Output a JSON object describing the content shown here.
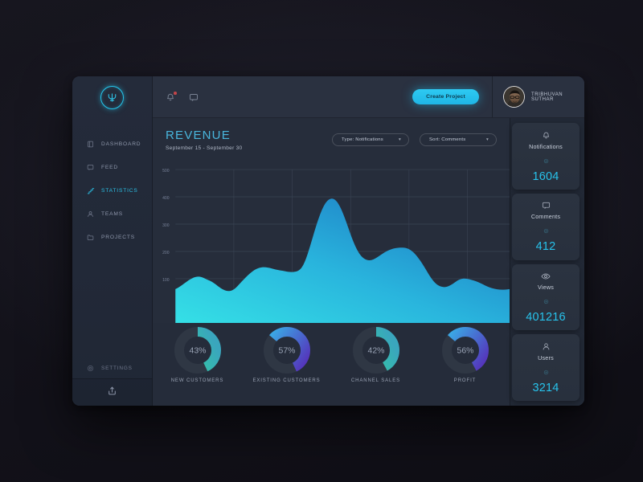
{
  "brand": {
    "logo_icon": "trident-logo-icon"
  },
  "sidebar": {
    "items": [
      {
        "label": "DASHBOARD",
        "icon": "dashboard-icon",
        "active": false
      },
      {
        "label": "FEED",
        "icon": "feed-icon",
        "active": false
      },
      {
        "label": "STATISTICS",
        "icon": "statistics-icon",
        "active": true
      },
      {
        "label": "TEAMS",
        "icon": "teams-icon",
        "active": false
      },
      {
        "label": "PROJECTS",
        "icon": "projects-icon",
        "active": false
      }
    ],
    "settings": {
      "label": "SETTINGS",
      "icon": "gear-icon"
    },
    "share": {
      "icon": "share-upload-icon"
    }
  },
  "topbar": {
    "notifications_icon": "bell-icon",
    "messages_icon": "message-icon",
    "has_notification_badge": true,
    "create_button": "Create Project",
    "user": {
      "name": "TRIBHUVAN SUTHAR",
      "avatar_icon": "avatar"
    }
  },
  "main": {
    "title": "REVENUE",
    "subtitle": "September 15 - September 30",
    "filters": [
      {
        "label": "Type: Notifications",
        "icon": "chevron-down-icon"
      },
      {
        "label": "Sort: Comments",
        "icon": "chevron-down-icon"
      }
    ]
  },
  "chart_data": {
    "type": "area",
    "title": "REVENUE",
    "subtitle": "September 15 - September 30",
    "xlabel": "",
    "ylabel": "",
    "ylim": [
      0,
      560
    ],
    "yticks": [
      100,
      200,
      300,
      400,
      500
    ],
    "ytick_labels": [
      "100",
      "200",
      "300",
      "400",
      "500"
    ],
    "grid": true,
    "legend": false,
    "x": [
      0,
      1,
      2,
      3,
      4,
      5,
      6,
      7,
      8,
      9,
      10,
      11,
      12,
      13,
      14,
      15,
      16,
      17,
      18,
      19,
      20,
      21,
      22,
      23,
      24,
      25,
      26,
      27,
      28,
      29
    ],
    "values": [
      60,
      78,
      100,
      105,
      88,
      62,
      58,
      70,
      95,
      130,
      150,
      152,
      145,
      138,
      140,
      185,
      330,
      440,
      400,
      300,
      200,
      185,
      195,
      215,
      220,
      205,
      150,
      95,
      80,
      110
    ],
    "series": [
      {
        "name": "Revenue",
        "values": [
          60,
          78,
          100,
          105,
          88,
          62,
          58,
          70,
          95,
          130,
          150,
          152,
          145,
          138,
          140,
          185,
          330,
          440,
          400,
          300,
          200,
          185,
          195,
          215,
          220,
          205,
          150,
          95,
          80,
          110
        ]
      }
    ],
    "colors": {
      "fill_start": "#31d8e4",
      "fill_end": "#1c74c0"
    }
  },
  "donuts": [
    {
      "label": "NEW CUSTOMERS",
      "value": 43,
      "display": "43%",
      "color_start": "#2fd39a",
      "color_end": "#3aa6bd"
    },
    {
      "label": "EXISTING CUSTOMERS",
      "value": 57,
      "display": "57%",
      "color_start": "#3ba6e4",
      "color_end": "#5533bb"
    },
    {
      "label": "CHANNEL SALES",
      "value": 42,
      "display": "42%",
      "color_start": "#2fd39a",
      "color_end": "#3aa6bd"
    },
    {
      "label": "PROFIT",
      "value": 56,
      "display": "56%",
      "color_start": "#3ba6e4",
      "color_end": "#5533bb"
    }
  ],
  "stats": [
    {
      "name": "Notifications",
      "value": "1604",
      "icon": "bell-icon"
    },
    {
      "name": "Comments",
      "value": "412",
      "icon": "message-icon"
    },
    {
      "name": "Views",
      "value": "401216",
      "icon": "eye-icon"
    },
    {
      "name": "Users",
      "value": "3214",
      "icon": "user-icon"
    }
  ],
  "theme": {
    "accent": "#27c3ec",
    "title": "#49b6dd",
    "panel": "#262d3b",
    "sidebar": "#242b3a"
  }
}
